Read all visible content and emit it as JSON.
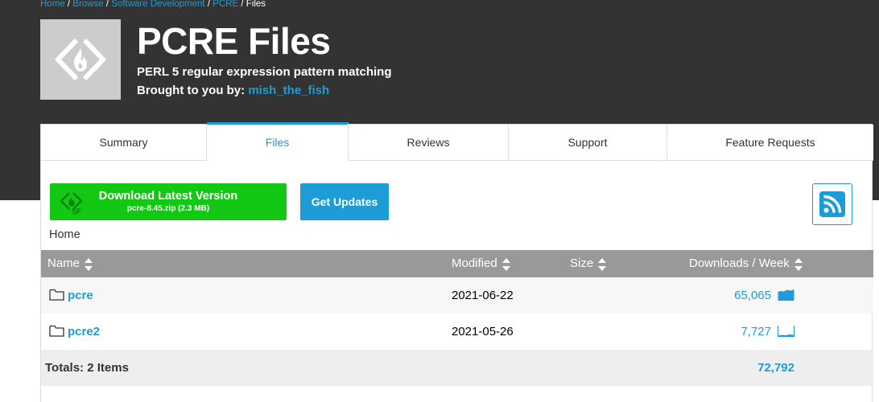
{
  "breadcrumb": {
    "items": [
      "Home",
      "Browse",
      "Software Development",
      "PCRE"
    ],
    "current": "Files",
    "separator": "/"
  },
  "project": {
    "title": "PCRE Files",
    "summary": "PERL 5 regular expression pattern matching",
    "brought_by_label": "Brought to you by:",
    "author": "mish_the_fish",
    "logo_icon": "sourceforge-logo-icon"
  },
  "tabs": [
    {
      "label": "Summary",
      "active": false
    },
    {
      "label": "Files",
      "active": true
    },
    {
      "label": "Reviews",
      "active": false
    },
    {
      "label": "Support",
      "active": false
    },
    {
      "label": "Feature Requests",
      "active": false
    }
  ],
  "download": {
    "label": "Download Latest Version",
    "file": "pcre-8.45.zip (2.3 MB)",
    "icon": "sourceforge-icon"
  },
  "updates_button": "Get Updates",
  "rss_icon": "rss-icon",
  "path_label": "Home",
  "table": {
    "columns": [
      "Name",
      "Modified",
      "Size",
      "Downloads / Week"
    ],
    "rows": [
      {
        "name": "pcre",
        "modified": "2021-06-22",
        "size": "",
        "downloads": "65,065",
        "icon": "folder-icon",
        "trend_fill": 1.0
      },
      {
        "name": "pcre2",
        "modified": "2021-05-26",
        "size": "",
        "downloads": "7,727",
        "icon": "folder-icon",
        "trend_fill": 0.1
      }
    ],
    "totals_label": "Totals: 2 Items",
    "totals_downloads": "72,792"
  },
  "colors": {
    "header_bg": "#333333",
    "accent_blue": "#1e9cd7",
    "download_green": "#12c813",
    "table_header": "#999999",
    "logo_bg": "#cccccc"
  }
}
